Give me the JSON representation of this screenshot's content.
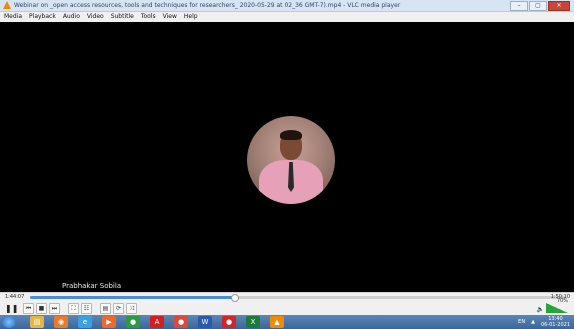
{
  "window": {
    "title": "Webinar on _open access resources, tools and techniques for researchers_ 2020-05-29 at 02_36 GMT-7).mp4 - VLC media player",
    "controls": [
      "–",
      "▢",
      "✕"
    ]
  },
  "menu": [
    "Media",
    "Playback",
    "Audio",
    "Video",
    "Subtitle",
    "Tools",
    "View",
    "Help"
  ],
  "video": {
    "caption": "Prabhakar Sobila"
  },
  "player": {
    "time_elapsed": "1:44:07",
    "time_total": "1:50:10",
    "progress": 0.38,
    "volume_percent": "70%",
    "buttons": [
      "❚❚",
      "⏮",
      "■",
      "⏭",
      "⛶",
      "☷",
      "▤",
      "⟳",
      "⤨"
    ]
  },
  "taskbar": {
    "lang": "EN",
    "time": "13:40",
    "date": "06-01-2021",
    "apps": [
      {
        "name": "file-explorer",
        "glyph": "▤",
        "color": "#e4b646"
      },
      {
        "name": "firefox",
        "glyph": "◉",
        "color": "#e97a2a"
      },
      {
        "name": "ie",
        "glyph": "e",
        "color": "#3aa0e0"
      },
      {
        "name": "media",
        "glyph": "▶",
        "color": "#ef6a2a"
      },
      {
        "name": "chrome",
        "glyph": "●",
        "color": "#2e9a3e"
      },
      {
        "name": "acrobat",
        "glyph": "A",
        "color": "#d3201f"
      },
      {
        "name": "chrome2",
        "glyph": "●",
        "color": "#d94a3a"
      },
      {
        "name": "word",
        "glyph": "W",
        "color": "#2a5aa8"
      },
      {
        "name": "record",
        "glyph": "●",
        "color": "#d32525"
      },
      {
        "name": "excel",
        "glyph": "X",
        "color": "#1e7a3c"
      },
      {
        "name": "vlc",
        "glyph": "▲",
        "color": "#f08a00"
      }
    ]
  }
}
